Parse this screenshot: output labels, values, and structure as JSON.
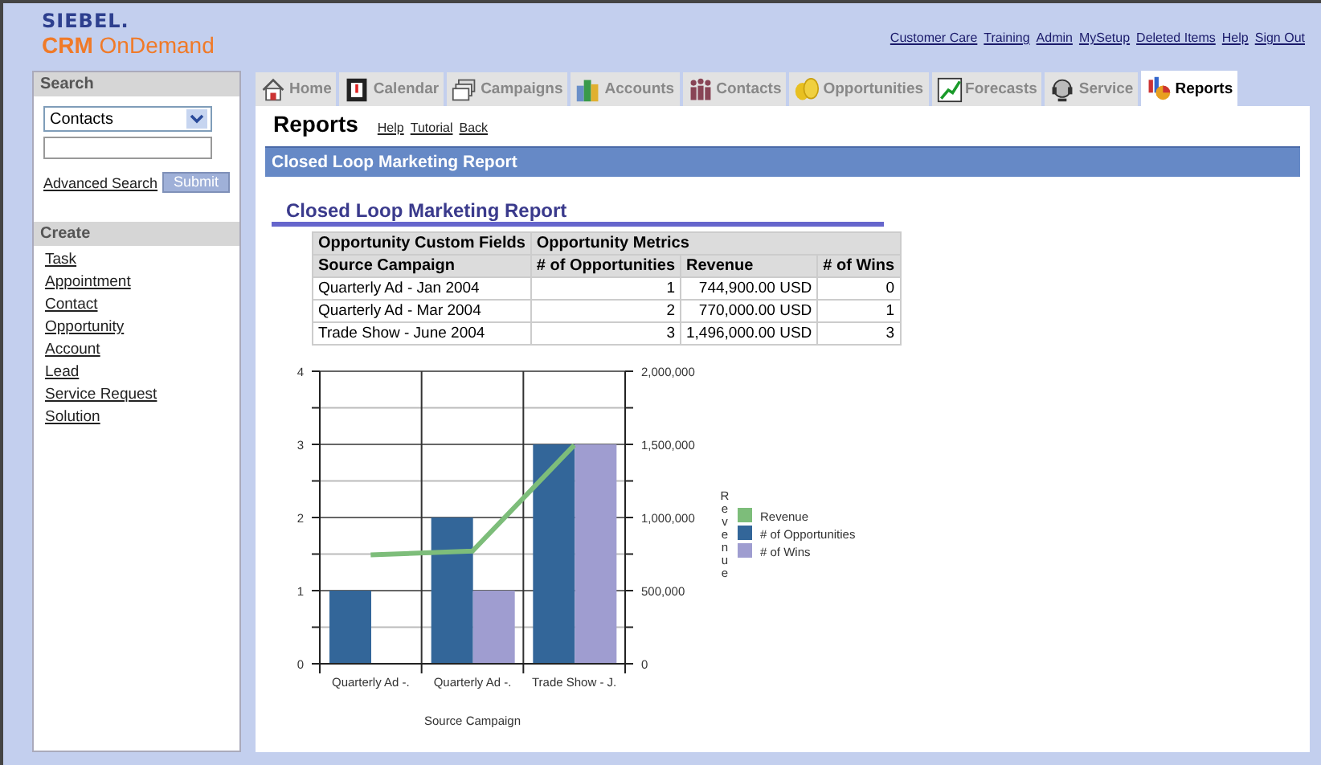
{
  "logo": {
    "brand": "SIEBEL.",
    "product_bold": "CRM",
    "product": "OnDemand"
  },
  "top_links": [
    "Customer Care",
    "Training",
    "Admin",
    "MySetup",
    "Deleted Items",
    "Help",
    "Sign Out"
  ],
  "search": {
    "title": "Search",
    "object": "Contacts",
    "advanced": "Advanced Search",
    "submit": "Submit"
  },
  "create": {
    "title": "Create",
    "items": [
      "Task",
      "Appointment",
      "Contact",
      "Opportunity",
      "Account",
      "Lead",
      "Service Request",
      "Solution"
    ]
  },
  "tabs": [
    {
      "kind": "home",
      "label": "Home",
      "selected": false
    },
    {
      "kind": "calendar",
      "label": "Calendar",
      "selected": false
    },
    {
      "kind": "campaigns",
      "label": "Campaigns",
      "selected": false
    },
    {
      "kind": "accounts",
      "label": "Accounts",
      "selected": false
    },
    {
      "kind": "contacts",
      "label": "Contacts",
      "selected": false
    },
    {
      "kind": "opportunities",
      "label": "Opportunities",
      "selected": false
    },
    {
      "kind": "forecasts",
      "label": "Forecasts",
      "selected": false
    },
    {
      "kind": "service",
      "label": "Service",
      "selected": false
    },
    {
      "kind": "reports",
      "label": "Reports",
      "selected": true
    }
  ],
  "page": {
    "title": "Reports",
    "links": [
      "Help",
      "Tutorial",
      "Back"
    ],
    "banner": "Closed Loop Marketing Report"
  },
  "report": {
    "title": "Closed Loop Marketing Report",
    "table": {
      "groups": [
        "Opportunity Custom Fields",
        "Opportunity Metrics"
      ],
      "columns": [
        "Source Campaign",
        "# of Opportunities",
        "Revenue",
        "# of Wins"
      ],
      "rows": [
        [
          "Quarterly Ad - Jan 2004",
          "1",
          "744,900.00 USD",
          "0"
        ],
        [
          "Quarterly Ad - Mar 2004",
          "2",
          "770,000.00 USD",
          "1"
        ],
        [
          "Trade Show - June 2004",
          "3",
          "1,496,000.00 USD",
          "3"
        ]
      ]
    },
    "chart_data": {
      "type": "bar",
      "xlabel": "Source Campaign",
      "y2label": "Revenue",
      "categories": [
        "Quarterly Ad -.",
        "Quarterly Ad -.",
        "Trade Show - J."
      ],
      "grid": true,
      "legend": true,
      "ylim": [
        0,
        4
      ],
      "yticks": [
        {
          "value": 0,
          "label": "0"
        },
        {
          "value": 1,
          "label": "1"
        },
        {
          "value": 2,
          "label": "2"
        },
        {
          "value": 3,
          "label": "3"
        },
        {
          "value": 4,
          "label": "4"
        }
      ],
      "y2lim": [
        0,
        2000000
      ],
      "y2ticks": [
        {
          "value": 0,
          "label": "0"
        },
        {
          "value": 500000,
          "label": "500,000"
        },
        {
          "value": 1000000,
          "label": "1,000,000"
        },
        {
          "value": 1500000,
          "label": "1,500,000"
        },
        {
          "value": 2000000,
          "label": "2,000,000"
        }
      ],
      "series": [
        {
          "name": "Revenue",
          "color": "#7dbd7a",
          "type": "line",
          "axis": "y2",
          "values": [
            745000,
            770000,
            1495000
          ]
        },
        {
          "name": "# of Opportunities",
          "color": "#336699",
          "type": "bar",
          "values": [
            1,
            2,
            3
          ]
        },
        {
          "name": "# of Wins",
          "color": "#9f9dd0",
          "type": "bar",
          "values": [
            0,
            1,
            3
          ]
        }
      ]
    }
  }
}
